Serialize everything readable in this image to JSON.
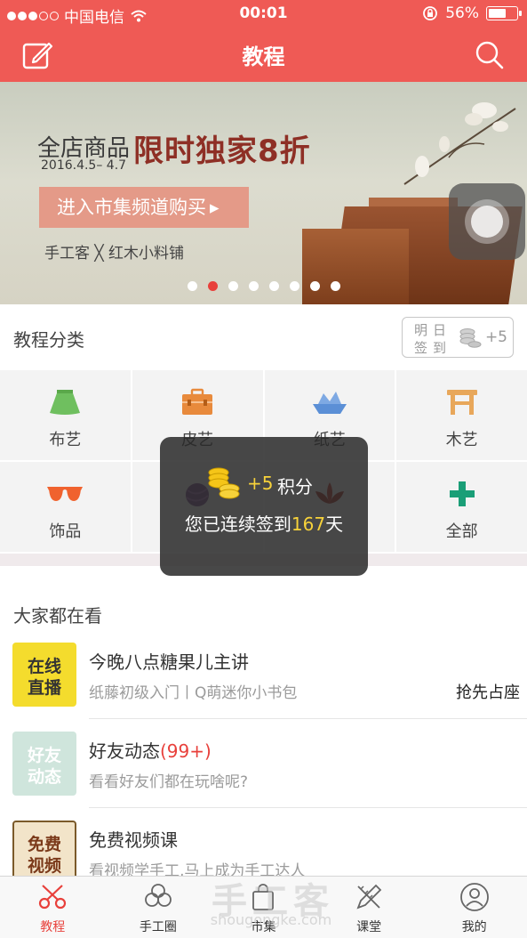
{
  "status": {
    "carrier": "中国电信",
    "time": "00:01",
    "battery": "56%"
  },
  "header": {
    "title": "教程"
  },
  "banner": {
    "line1": "全店商品",
    "headline": "限时独家8折",
    "date": "2016.4.5– 4.7",
    "button_label": "进入市集频道购买",
    "brand": "手工客 ╳ 红木小料铺",
    "page_count": 8,
    "active_page": 1
  },
  "categories": {
    "title": "教程分类",
    "signin": {
      "line1": "明日",
      "line2": "签到",
      "bonus": "+5"
    },
    "items": [
      {
        "label": "布艺",
        "icon": "skirt-icon",
        "color": "#6fbf5f"
      },
      {
        "label": "皮艺",
        "icon": "briefcase-icon",
        "color": "#e88a3c"
      },
      {
        "label": "纸艺",
        "icon": "paper-boat-icon",
        "color": "#5b8fd6"
      },
      {
        "label": "木艺",
        "icon": "stool-icon",
        "color": "#e8a75a"
      },
      {
        "label": "饰品",
        "icon": "sunglasses-icon",
        "color": "#f0622e"
      },
      {
        "label": "",
        "icon": "yarn-icon",
        "color": "#7a4a8c"
      },
      {
        "label": "",
        "icon": "lotus-icon",
        "color": "#c0392b"
      },
      {
        "label": "全部",
        "icon": "plus-icon",
        "color": "#1a9e77"
      }
    ]
  },
  "toast": {
    "bonus": "+5",
    "points_label": "积分",
    "message_prefix": "您已连续签到",
    "days": "167",
    "message_suffix": "天"
  },
  "watching": {
    "title": "大家都在看",
    "items": [
      {
        "thumb_text_1": "在线",
        "thumb_text_2": "直播",
        "title": "今晚八点糖果儿主讲",
        "subtitle": "纸藤初级入门丨Q萌迷你小书包",
        "action": "抢先占座"
      },
      {
        "thumb_text_1": "好友",
        "thumb_text_2": "动态",
        "title": "好友动态",
        "count": "(99+)",
        "subtitle": "看看好友们都在玩啥呢?"
      },
      {
        "thumb_text_1": "免费",
        "thumb_text_2": "视频",
        "title": "免费视频课",
        "subtitle": "看视频学手工,马上成为手工达人"
      }
    ]
  },
  "tabbar": {
    "items": [
      {
        "label": "教程",
        "icon": "scissors-icon",
        "active": true
      },
      {
        "label": "手工圈",
        "icon": "circle-flower-icon",
        "active": false
      },
      {
        "label": "市集",
        "icon": "shopping-bag-icon",
        "active": false
      },
      {
        "label": "课堂",
        "icon": "pencil-ruler-icon",
        "active": false
      },
      {
        "label": "我的",
        "icon": "profile-icon",
        "active": false
      }
    ]
  },
  "watermark": {
    "text": "手工客",
    "url": "shougongke.com"
  },
  "colors": {
    "brand": "#ef5a55",
    "accent": "#e8403b",
    "highlight": "#f7d23a"
  }
}
